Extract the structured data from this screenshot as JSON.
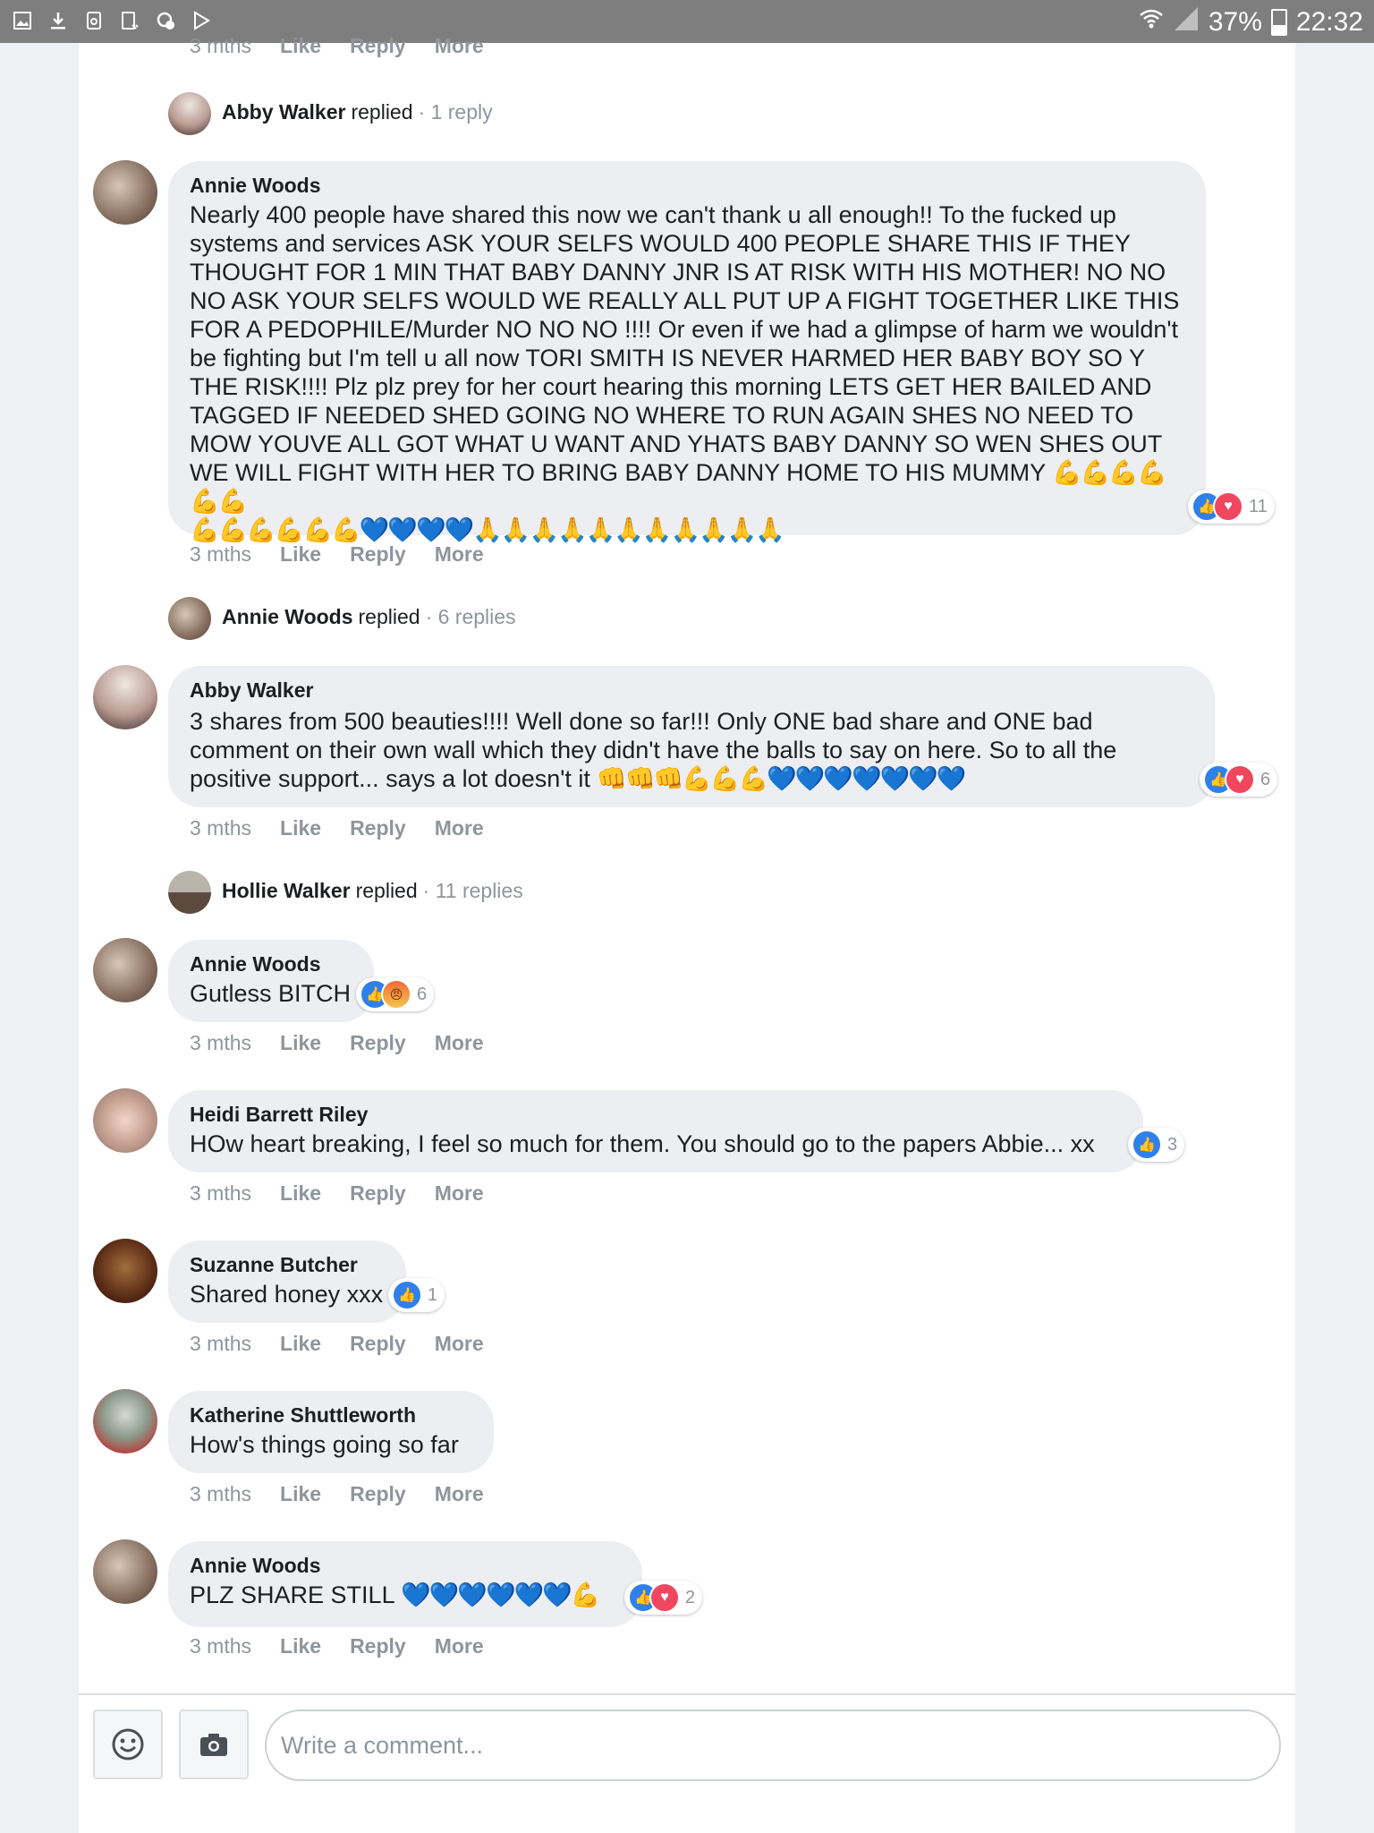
{
  "status_bar": {
    "battery": "37%",
    "time": "22:32",
    "left_icons": [
      "gallery-icon",
      "download-icon",
      "recycle-icon",
      "tablet-icon",
      "settings-dot-icon",
      "play-store-icon"
    ]
  },
  "top_meta": {
    "time": "3 mths",
    "like": "Like",
    "reply": "Reply",
    "more": "More"
  },
  "thread1_replied": {
    "name": "Abby Walker",
    "verb": "replied",
    "count": "· 1 reply"
  },
  "comments": [
    {
      "name": "Annie Woods",
      "text": "Nearly 400 people have shared this now we can't thank u all enough!! To the fucked up systems and services ASK YOUR SELFS WOULD 400 PEOPLE SHARE THIS IF THEY THOUGHT FOR 1 MIN THAT BABY DANNY JNR IS AT RISK WITH HIS MOTHER! NO NO NO ASK YOUR SELFS WOULD WE REALLY ALL PUT UP A FIGHT TOGETHER LIKE THIS FOR A PEDOPHILE/Murder NO NO NO !!!! Or even if we had a glimpse of harm we wouldn't be fighting but I'm tell u all now TORI SMITH IS NEVER HARMED HER BABY BOY SO Y THE RISK!!!! Plz plz prey for her court hearing this morning LETS GET HER BAILED AND TAGGED IF NEEDED SHED GOING NO WHERE TO RUN AGAIN SHES NO NEED TO MOW YOUVE ALL GOT WHAT U WANT AND YHATS BABY DANNY SO WEN SHES OUT WE WILL FIGHT WITH HER TO BRING BABY DANNY HOME TO HIS MUMMY",
      "emoji_line1": "💪💪💪💪💪💪",
      "emoji_line2_m": "💪💪💪💪💪💪",
      "emoji_line2_h": "💙💙💙💙",
      "emoji_line2_p": "🙏🙏🙏🙏🙏🙏🙏🙏🙏🙏🙏",
      "reactions": "11",
      "time": "3 mths",
      "like": "Like",
      "reply": "Reply",
      "more": "More"
    },
    {
      "name": "Abby Walker",
      "text": "3 shares from 500 beauties!!!! Well done so far!!! Only ONE bad share and ONE bad comment on their own wall which they didn't have the balls to say on here. So to all the positive support... says a lot doesn't it",
      "emoji_f": "👊👊👊",
      "emoji_m": "💪💪💪",
      "emoji_h": "💙💙💙💙💙💙💙",
      "reactions": "6",
      "time": "3 mths",
      "like": "Like",
      "reply": "Reply",
      "more": "More"
    },
    {
      "name": "Annie Woods",
      "text": "Gutless BITCH",
      "reactions": "6",
      "time": "3 mths",
      "like": "Like",
      "reply": "Reply",
      "more": "More"
    },
    {
      "name": "Heidi Barrett Riley",
      "text": "HOw heart breaking, I feel so much for them. You should go to the papers Abbie... xx",
      "reactions": "3",
      "time": "3 mths",
      "like": "Like",
      "reply": "Reply",
      "more": "More"
    },
    {
      "name": "Suzanne Butcher",
      "text": "Shared honey xxx",
      "reactions": "1",
      "time": "3 mths",
      "like": "Like",
      "reply": "Reply",
      "more": "More"
    },
    {
      "name": "Katherine Shuttleworth",
      "text": "How's things going so far",
      "time": "3 mths",
      "like": "Like",
      "reply": "Reply",
      "more": "More"
    },
    {
      "name": "Annie Woods",
      "text": "PLZ SHARE STILL",
      "emoji_h": "💙💙💙💙💙💙",
      "emoji_m": "💪",
      "reactions": "2",
      "time": "3 mths",
      "like": "Like",
      "reply": "Reply",
      "more": "More"
    }
  ],
  "replied2": {
    "name": "Annie Woods",
    "verb": "replied",
    "count": "· 6 replies"
  },
  "replied3": {
    "name": "Hollie Walker",
    "verb": "replied",
    "count": "· 11 replies"
  },
  "composer": {
    "placeholder": "Write a comment..."
  }
}
